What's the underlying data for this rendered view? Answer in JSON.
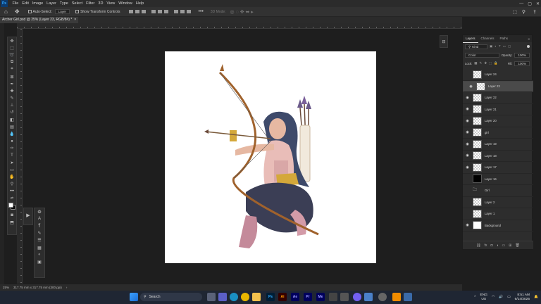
{
  "menu": [
    "File",
    "Edit",
    "Image",
    "Layer",
    "Type",
    "Select",
    "Filter",
    "3D",
    "View",
    "Window",
    "Help"
  ],
  "app_logo": "Ps",
  "options": {
    "auto_select_label": "Auto-Select:",
    "auto_select_value": "Layer",
    "transform_label": "Show Transform Controls",
    "mode_3d_label": "3D Mode:"
  },
  "doc_tab": {
    "title": "Archer Girl.psd @ 25% (Layer 23, RGB/8#) *",
    "close": "×"
  },
  "layers_panel": {
    "tabs": [
      "Layers",
      "Channels",
      "Paths"
    ],
    "filter_label": "Kind",
    "blend_mode": "Color",
    "opacity_label": "Opacity:",
    "opacity_value": "100%",
    "lock_label": "Lock:",
    "fill_label": "Fill:",
    "fill_value": "100%",
    "layers": [
      {
        "name": "Layer 24",
        "visible": false,
        "selected": false,
        "thumb": "checker"
      },
      {
        "name": "Layer 23",
        "visible": true,
        "selected": true,
        "thumb": "checker"
      },
      {
        "name": "Layer 22",
        "visible": true,
        "selected": false,
        "thumb": "checker"
      },
      {
        "name": "Layer 21",
        "visible": true,
        "selected": false,
        "thumb": "checker"
      },
      {
        "name": "Layer 20",
        "visible": true,
        "selected": false,
        "thumb": "checker"
      },
      {
        "name": "girl",
        "visible": true,
        "selected": false,
        "thumb": "checker"
      },
      {
        "name": "Layer 19",
        "visible": true,
        "selected": false,
        "thumb": "checker"
      },
      {
        "name": "Layer 18",
        "visible": true,
        "selected": false,
        "thumb": "checker"
      },
      {
        "name": "Layer 17",
        "visible": true,
        "selected": false,
        "thumb": "checker"
      },
      {
        "name": "Layer 16",
        "visible": false,
        "selected": false,
        "thumb": "black"
      },
      {
        "name": "Girl",
        "visible": false,
        "selected": false,
        "thumb": "folder"
      },
      {
        "name": "Layer 2",
        "visible": false,
        "selected": false,
        "thumb": "checker"
      },
      {
        "name": "Layer 1",
        "visible": false,
        "selected": false,
        "thumb": "checker"
      },
      {
        "name": "Background",
        "visible": true,
        "selected": false,
        "thumb": "white"
      }
    ]
  },
  "status": {
    "zoom": "25%",
    "doc_size": "317.75 mm x 317.75 mm (300 ppi)"
  },
  "taskbar": {
    "search_placeholder": "Search",
    "lang": "ENG",
    "region": "US",
    "time": "8:51 AM",
    "date": "6/14/2025"
  },
  "colors": {
    "ps_blue": "#31a8ff",
    "selected_row": "#4a4a4a",
    "workspace": "#1e1e1e"
  }
}
